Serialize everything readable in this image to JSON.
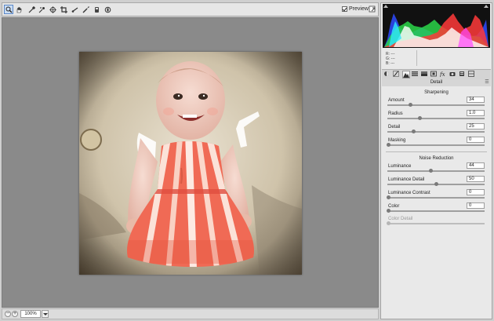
{
  "toolbar": {
    "tools": [
      {
        "name": "zoom-tool",
        "icon": "magnifier-icon",
        "active": true
      },
      {
        "name": "hand-tool",
        "icon": "hand-icon"
      },
      {
        "name": "white-balance-tool",
        "icon": "eyedropper-icon"
      },
      {
        "name": "color-sampler-tool",
        "icon": "color-sampler-icon"
      },
      {
        "name": "targeted-adjustment-tool",
        "icon": "target-adjust-icon"
      },
      {
        "name": "crop-tool",
        "icon": "crop-icon"
      },
      {
        "name": "straighten-tool",
        "icon": "straighten-icon"
      },
      {
        "name": "red-eye-tool",
        "icon": "red-eye-icon"
      },
      {
        "name": "adjustment-brush-tool",
        "icon": "brush-icon"
      },
      {
        "name": "graduated-filter-tool",
        "icon": "graduated-filter-icon"
      },
      {
        "name": "rotate-tool",
        "icon": "rotate-icon"
      }
    ],
    "preview_label": "Preview",
    "preview_checked": true
  },
  "status": {
    "zoom_out": "−",
    "zoom_in": "+",
    "zoom_value": "100%"
  },
  "readout": {
    "r_label": "R:",
    "r_value": "---",
    "g_label": "G:",
    "g_value": "---",
    "b_label": "B:",
    "b_value": "---"
  },
  "panel": {
    "title": "Detail",
    "tabs": [
      "basic",
      "tone-curve",
      "detail",
      "hsl",
      "split-toning",
      "lens-corrections",
      "effects",
      "camera-calibration",
      "presets",
      "snapshots"
    ],
    "active_tab": "detail",
    "sharpening": {
      "title": "Sharpening",
      "sliders": [
        {
          "label": "Amount",
          "value": "34",
          "fraction": 0.23
        },
        {
          "label": "Radius",
          "value": "1.0",
          "fraction": 0.33
        },
        {
          "label": "Detail",
          "value": "25",
          "fraction": 0.26
        },
        {
          "label": "Masking",
          "value": "0",
          "fraction": 0.0
        }
      ]
    },
    "noise": {
      "title": "Noise Reduction",
      "sliders": [
        {
          "label": "Luminance",
          "value": "44",
          "fraction": 0.44,
          "enabled": true
        },
        {
          "label": "Luminance Detail",
          "value": "50",
          "fraction": 0.5,
          "enabled": true
        },
        {
          "label": "Luminance Contrast",
          "value": "0",
          "fraction": 0.0,
          "enabled": true
        },
        {
          "label": "Color",
          "value": "0",
          "fraction": 0.0,
          "enabled": true
        },
        {
          "label": "Color Detail",
          "value": "",
          "fraction": 0.0,
          "enabled": false
        }
      ]
    }
  },
  "colors": {
    "canvas_bg": "#8a8a8a",
    "panel_bg": "#e9e9e9",
    "histogram_bg": "#111111"
  }
}
